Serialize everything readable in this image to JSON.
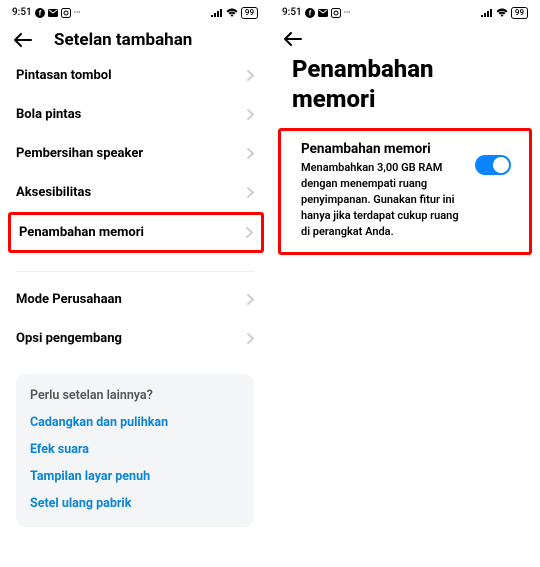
{
  "statusbar": {
    "time": "9:51",
    "battery": "99"
  },
  "left": {
    "title": "Setelan tambahan",
    "items": [
      "Pintasan tombol",
      "Bola pintas",
      "Pembersihan speaker",
      "Aksesibilitas",
      "Penambahan memori"
    ],
    "items2": [
      "Mode Perusahaan",
      "Opsi pengembang"
    ],
    "info": {
      "heading": "Perlu setelan lainnya?",
      "links": [
        "Cadangkan dan pulihkan",
        "Efek suara",
        "Tampilan layar penuh",
        "Setel ulang pabrik"
      ]
    }
  },
  "right": {
    "title": "Penambahan memori",
    "card": {
      "title": "Penambahan memori",
      "desc": "Menambahkan 3,00 GB RAM dengan menempati ruang penyimpanan. Gunakan fitur ini hanya jika terdapat cukup ruang di perangkat Anda."
    }
  }
}
